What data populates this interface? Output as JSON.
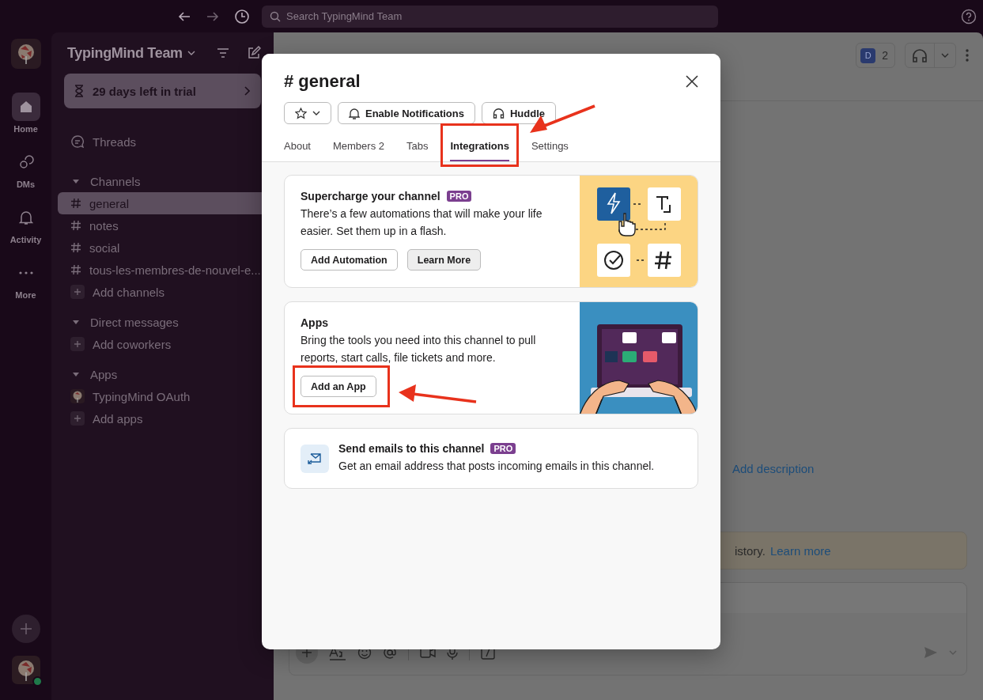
{
  "top_bar": {
    "search": {
      "placeholder": "Search TypingMind Team"
    }
  },
  "rail": {
    "items": [
      {
        "kind": "home",
        "label": "Home",
        "selected": true
      },
      {
        "kind": "dms",
        "label": "DMs",
        "selected": false
      },
      {
        "kind": "activity",
        "label": "Activity",
        "selected": false
      },
      {
        "kind": "more",
        "label": "More",
        "selected": false
      }
    ],
    "user": {
      "online": true
    }
  },
  "sidebar": {
    "workspace": "TypingMind Team",
    "trial": "29 days left in trial",
    "threads": "Threads",
    "sections": [
      {
        "title": "Channels",
        "expanded": true,
        "items": [
          {
            "kind": "channel",
            "label": "general",
            "selected": true
          },
          {
            "kind": "channel",
            "label": "notes",
            "selected": false
          },
          {
            "kind": "channel",
            "label": "social",
            "selected": false
          },
          {
            "kind": "channel",
            "label": "tous-les-membres-de-nouvel-e...",
            "selected": false
          },
          {
            "kind": "add",
            "label": "Add channels",
            "selected": false
          }
        ]
      },
      {
        "title": "Direct messages",
        "expanded": true,
        "items": [
          {
            "kind": "add",
            "label": "Add coworkers",
            "selected": false
          }
        ]
      },
      {
        "title": "Apps",
        "expanded": true,
        "items": [
          {
            "kind": "app",
            "label": "TypingMind OAuth",
            "selected": false
          },
          {
            "kind": "add",
            "label": "Add apps",
            "selected": false
          }
        ]
      }
    ]
  },
  "main": {
    "member_avatar": "D",
    "member_count": "2",
    "description_link": "Add description",
    "banner_tail": "istory.",
    "banner_link": "Learn more"
  },
  "modal": {
    "title": "# general",
    "actions": [
      {
        "kind": "star"
      },
      {
        "kind": "bell",
        "label": "Enable Notifications"
      },
      {
        "kind": "headphones",
        "label": "Huddle"
      }
    ],
    "tabs": [
      {
        "label": "About",
        "selected": false
      },
      {
        "label": "Members 2",
        "selected": false
      },
      {
        "label": "Tabs",
        "selected": false
      },
      {
        "label": "Integrations",
        "selected": true,
        "highlighted": true
      },
      {
        "label": "Settings",
        "selected": false
      }
    ],
    "cards": [
      {
        "kind": "automation",
        "title": "Supercharge your channel",
        "badge": "PRO",
        "text": "There’s a few automations that will make your life easier. Set them up in a flash.",
        "buttons": [
          {
            "label": "Add Automation",
            "primary": false
          },
          {
            "label": "Learn More",
            "primary": true
          }
        ]
      },
      {
        "kind": "apps",
        "title": "Apps",
        "text": "Bring the tools you need into this channel to pull reports, start calls, file tickets and more.",
        "buttons": [
          {
            "label": "Add an App",
            "primary": false,
            "highlighted": true
          }
        ]
      },
      {
        "kind": "email",
        "title": "Send emails to this channel",
        "badge": "PRO",
        "text": "Get an email address that posts incoming emails in this channel."
      }
    ]
  }
}
